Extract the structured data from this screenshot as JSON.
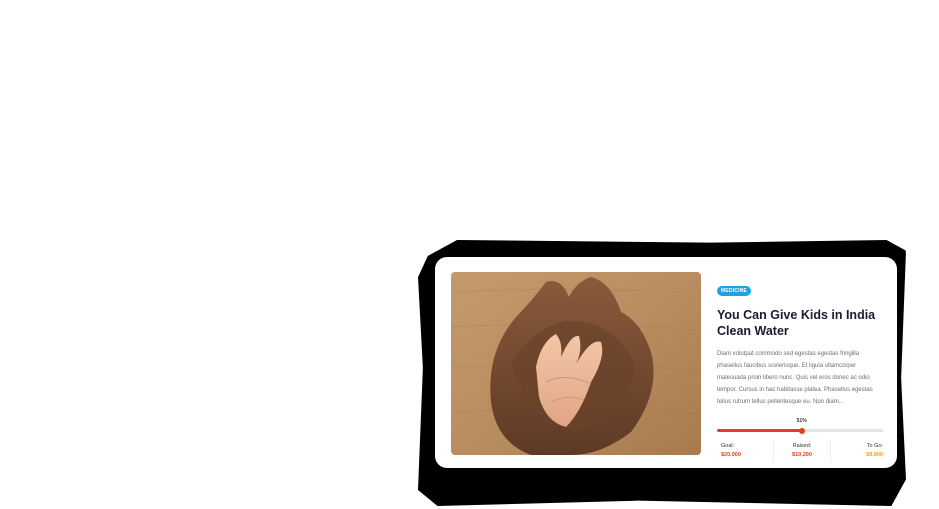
{
  "campaign": {
    "category_badge": "MEDICINE",
    "title": "You Can Give Kids in India Clean Water",
    "description": "Diam volutpat commodo sed egestas egestas fringilla phasellus faucibus scelerisque. Et ligula ullamcorper malesuada proin libero nunc. Quis vel eros donec ac odio tempor. Cursus in hac habitasse platea. Phasellus egestas tellus rutrum tellus pellentesque eu. Non diam...",
    "image_icon": "cupped-hands-photo",
    "progress": {
      "percent_label": "51%",
      "percent_value": 51
    },
    "stats": [
      {
        "label": "Goal:",
        "value": "$20,000"
      },
      {
        "label": "Raised:",
        "value": "$10,200"
      },
      {
        "label": "To Go:",
        "value": "$9,800"
      }
    ]
  },
  "colors": {
    "badge": "#1fa3e0",
    "progress": "#e0421e",
    "goal": "#e0421e",
    "raised": "#e0421e",
    "to_go": "#f0a11e"
  }
}
